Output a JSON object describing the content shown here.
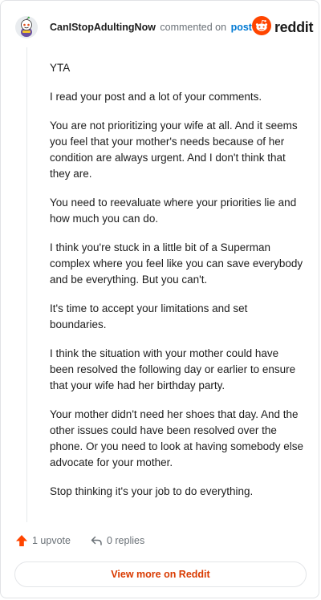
{
  "header": {
    "username": "CanIStopAdultingNow",
    "action": "commented on",
    "post_link": "post",
    "brand": "reddit",
    "avatar_icon": "snoo-avatar-icon",
    "logo_icon": "reddit-logo-icon"
  },
  "comment": {
    "paragraphs": [
      "YTA",
      "I read your post and a lot of your comments.",
      "You are not prioritizing your wife at all. And it seems you feel that your mother's needs because of her condition are always urgent. And I don't think that they are.",
      "You need to reevaluate where your priorities lie and how much you can do.",
      "I think you're stuck in a little bit of a Superman complex where you feel like you can save everybody and be everything. But you can't.",
      "It's time to accept your limitations and set boundaries.",
      "I think the situation with your mother could have been resolved the following day or earlier to ensure that your wife had her birthday party.",
      "Your mother didn't need her shoes that day. And the other issues could have been resolved over the phone. Or you need to look at having somebody else advocate for your mother.",
      "Stop thinking it's your job to do everything."
    ]
  },
  "footer": {
    "upvotes": "1 upvote",
    "replies": "0 replies",
    "upvote_icon": "upvote-arrow-icon",
    "reply_icon": "reply-icon"
  },
  "view_more": "View more on Reddit",
  "colors": {
    "reddit_orange": "#ff4500",
    "link_blue": "#0079d3",
    "view_more_text": "#d93a00",
    "muted_text": "#6a7177"
  }
}
